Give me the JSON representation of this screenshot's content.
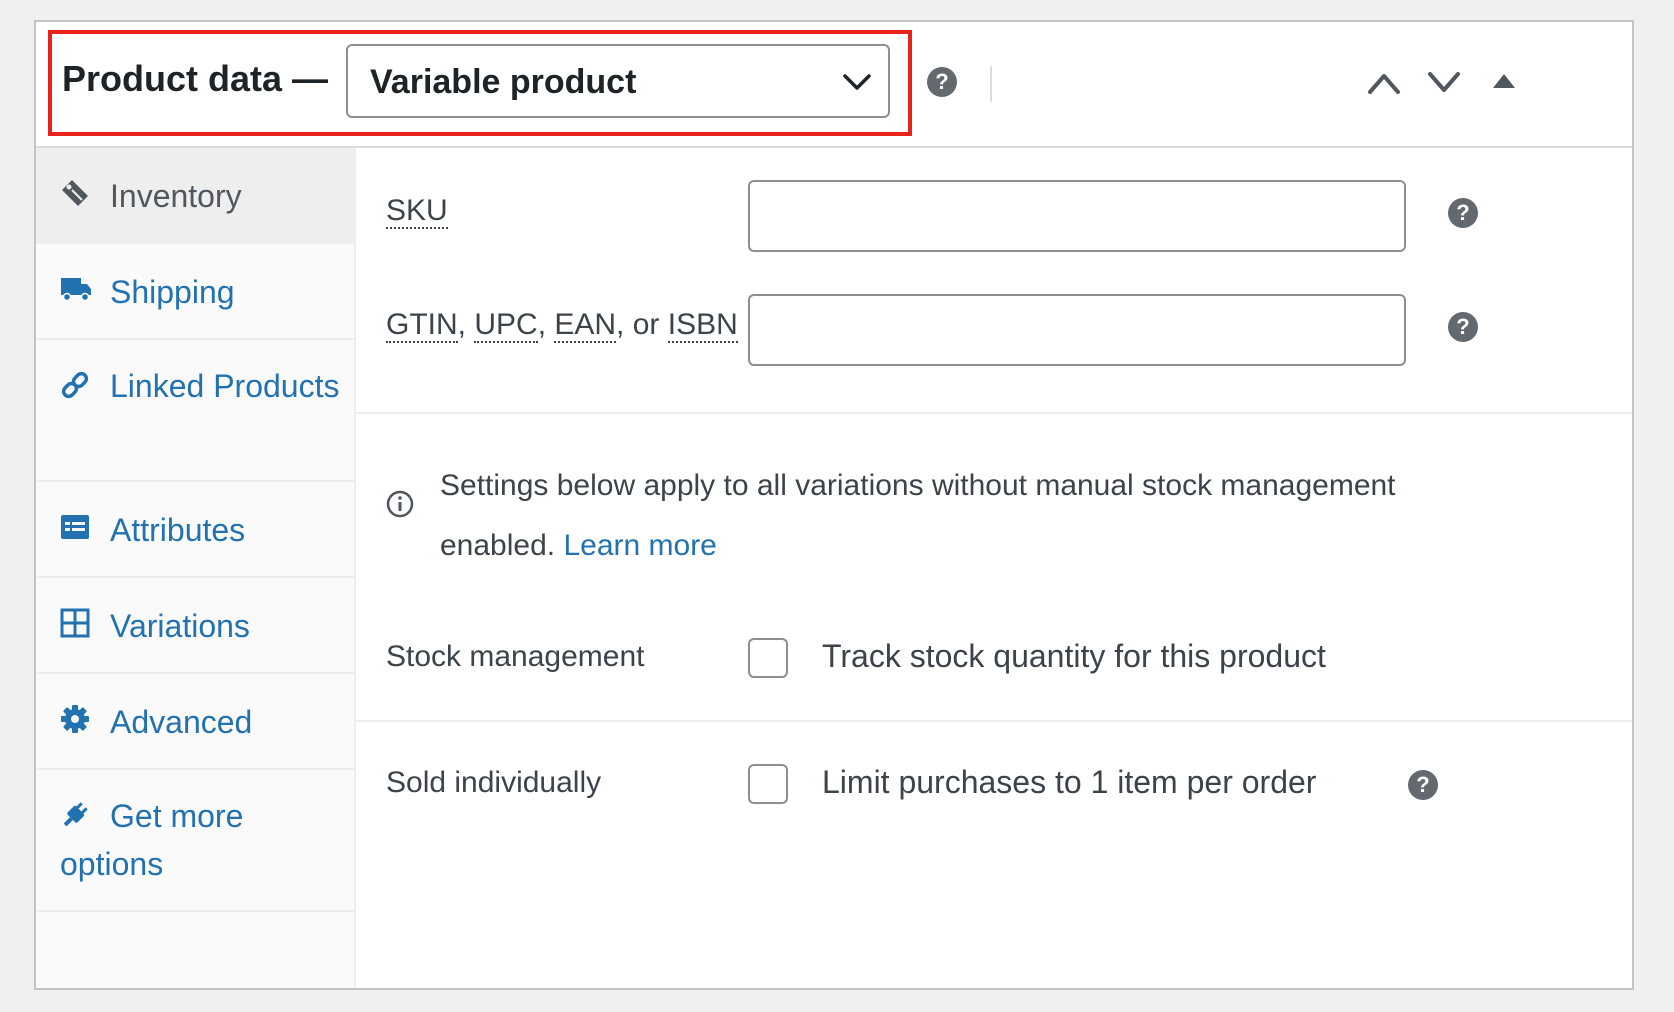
{
  "header": {
    "title": "Product data —",
    "product_type": "Variable product",
    "help_glyph": "?",
    "icons": [
      "chevron-down-icon",
      "help-icon",
      "move-up-icon",
      "move-down-icon",
      "toggle-panel-icon"
    ]
  },
  "tabs": [
    {
      "label": "Inventory",
      "icon": "tag-icon",
      "active": true
    },
    {
      "label": "Shipping",
      "icon": "truck-icon",
      "active": false
    },
    {
      "label": "Linked Products",
      "icon": "link-icon",
      "active": false
    },
    {
      "label": "Attributes",
      "icon": "list-icon",
      "active": false
    },
    {
      "label": "Variations",
      "icon": "grid-icon",
      "active": false
    },
    {
      "label": "Advanced",
      "icon": "gear-icon",
      "active": false
    },
    {
      "label": "Get more options",
      "icon": "plugin-icon",
      "active": false
    }
  ],
  "inventory": {
    "sku_label": "SKU",
    "gtin_label_parts": [
      "GTIN",
      ", ",
      "UPC",
      ", ",
      "EAN",
      ", or ",
      "ISBN"
    ],
    "sku_value": "",
    "gtin_value": "",
    "notice_text": "Settings below apply to all variations without manual stock management enabled.",
    "notice_link": "Learn more",
    "stock_management_label": "Stock management",
    "stock_management_checkbox": "Track stock quantity for this product",
    "sold_individually_label": "Sold individually",
    "sold_individually_checkbox": "Limit purchases to 1 item per order"
  },
  "colors": {
    "accent": "#2271b1",
    "highlight": "#e8231b",
    "help": "#646970"
  }
}
